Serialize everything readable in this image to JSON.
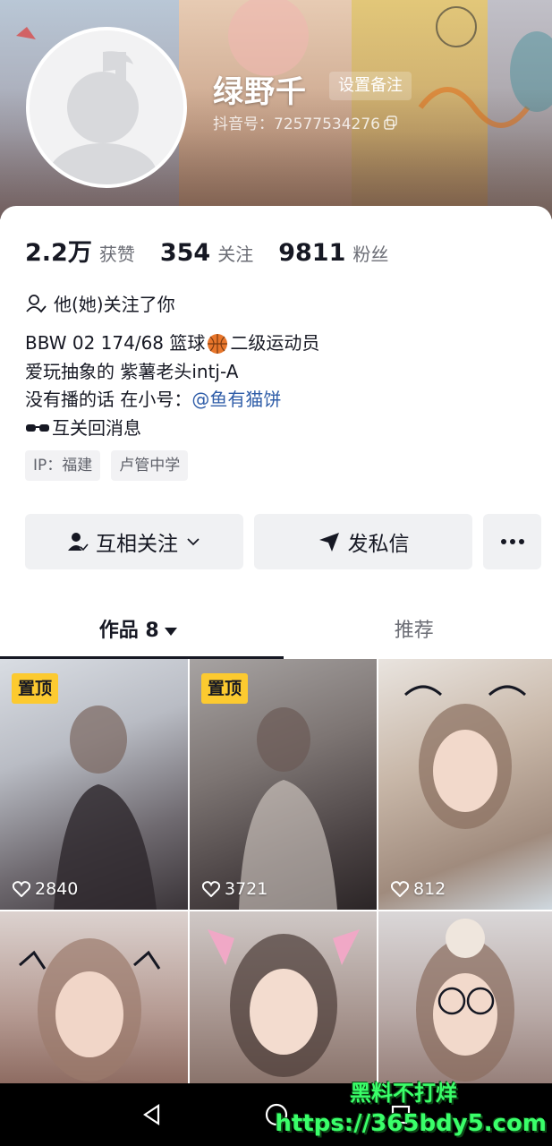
{
  "profile": {
    "nickname": "绿野千",
    "remark_button": "设置备注",
    "douyin_id": "抖音号：72577534276"
  },
  "stats": [
    {
      "value": "2.2万",
      "label": "获赞"
    },
    {
      "value": "354",
      "label": "关注"
    },
    {
      "value": "9811",
      "label": "粉丝"
    }
  ],
  "follows_you": "他(她)关注了你",
  "bio": {
    "line1_a": "BBW 02 174/68  篮球",
    "line1_b": "二级运动员",
    "line2": "爱玩抽象的 紫薯老头intj-A",
    "line3_a": "没有播的话 在小号：",
    "line3_mention": "@鱼有猫饼",
    "line4": "互关回消息"
  },
  "tags": [
    "IP：福建",
    "卢管中学"
  ],
  "actions": {
    "mutual_follow": "互相关注",
    "send_message": "发私信"
  },
  "tabs": {
    "works": "作品 8",
    "recommend": "推荐"
  },
  "videos": [
    {
      "pinned": true,
      "pin_label": "置顶",
      "likes": "2840"
    },
    {
      "pinned": true,
      "pin_label": "置顶",
      "likes": "3721"
    },
    {
      "pinned": false,
      "likes": "812"
    },
    {
      "pinned": false
    },
    {
      "pinned": false
    },
    {
      "pinned": false
    }
  ],
  "watermark": {
    "line1": "黑料不打烊",
    "line2": "https://365bdy5.com"
  },
  "colors": {
    "pin_badge": "#fcca30",
    "mention": "#2f5da8",
    "watermark": "#3aff6a"
  }
}
